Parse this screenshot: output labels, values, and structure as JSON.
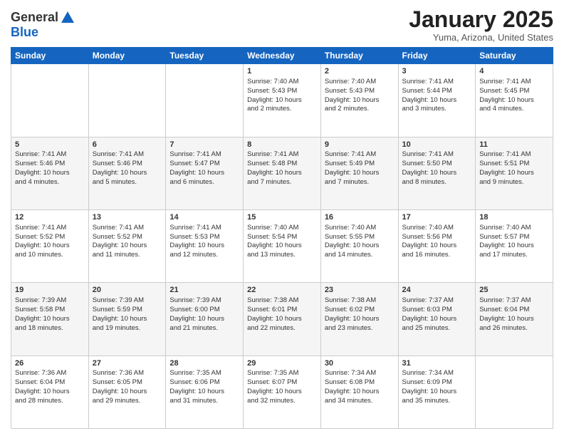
{
  "logo": {
    "general": "General",
    "blue": "Blue"
  },
  "header": {
    "month": "January 2025",
    "location": "Yuma, Arizona, United States"
  },
  "days_of_week": [
    "Sunday",
    "Monday",
    "Tuesday",
    "Wednesday",
    "Thursday",
    "Friday",
    "Saturday"
  ],
  "rows": [
    [
      {
        "day": "",
        "info": ""
      },
      {
        "day": "",
        "info": ""
      },
      {
        "day": "",
        "info": ""
      },
      {
        "day": "1",
        "info": "Sunrise: 7:40 AM\nSunset: 5:43 PM\nDaylight: 10 hours\nand 2 minutes."
      },
      {
        "day": "2",
        "info": "Sunrise: 7:40 AM\nSunset: 5:43 PM\nDaylight: 10 hours\nand 2 minutes."
      },
      {
        "day": "3",
        "info": "Sunrise: 7:41 AM\nSunset: 5:44 PM\nDaylight: 10 hours\nand 3 minutes."
      },
      {
        "day": "4",
        "info": "Sunrise: 7:41 AM\nSunset: 5:45 PM\nDaylight: 10 hours\nand 4 minutes."
      }
    ],
    [
      {
        "day": "5",
        "info": "Sunrise: 7:41 AM\nSunset: 5:46 PM\nDaylight: 10 hours\nand 4 minutes."
      },
      {
        "day": "6",
        "info": "Sunrise: 7:41 AM\nSunset: 5:46 PM\nDaylight: 10 hours\nand 5 minutes."
      },
      {
        "day": "7",
        "info": "Sunrise: 7:41 AM\nSunset: 5:47 PM\nDaylight: 10 hours\nand 6 minutes."
      },
      {
        "day": "8",
        "info": "Sunrise: 7:41 AM\nSunset: 5:48 PM\nDaylight: 10 hours\nand 7 minutes."
      },
      {
        "day": "9",
        "info": "Sunrise: 7:41 AM\nSunset: 5:49 PM\nDaylight: 10 hours\nand 7 minutes."
      },
      {
        "day": "10",
        "info": "Sunrise: 7:41 AM\nSunset: 5:50 PM\nDaylight: 10 hours\nand 8 minutes."
      },
      {
        "day": "11",
        "info": "Sunrise: 7:41 AM\nSunset: 5:51 PM\nDaylight: 10 hours\nand 9 minutes."
      }
    ],
    [
      {
        "day": "12",
        "info": "Sunrise: 7:41 AM\nSunset: 5:52 PM\nDaylight: 10 hours\nand 10 minutes."
      },
      {
        "day": "13",
        "info": "Sunrise: 7:41 AM\nSunset: 5:52 PM\nDaylight: 10 hours\nand 11 minutes."
      },
      {
        "day": "14",
        "info": "Sunrise: 7:41 AM\nSunset: 5:53 PM\nDaylight: 10 hours\nand 12 minutes."
      },
      {
        "day": "15",
        "info": "Sunrise: 7:40 AM\nSunset: 5:54 PM\nDaylight: 10 hours\nand 13 minutes."
      },
      {
        "day": "16",
        "info": "Sunrise: 7:40 AM\nSunset: 5:55 PM\nDaylight: 10 hours\nand 14 minutes."
      },
      {
        "day": "17",
        "info": "Sunrise: 7:40 AM\nSunset: 5:56 PM\nDaylight: 10 hours\nand 16 minutes."
      },
      {
        "day": "18",
        "info": "Sunrise: 7:40 AM\nSunset: 5:57 PM\nDaylight: 10 hours\nand 17 minutes."
      }
    ],
    [
      {
        "day": "19",
        "info": "Sunrise: 7:39 AM\nSunset: 5:58 PM\nDaylight: 10 hours\nand 18 minutes."
      },
      {
        "day": "20",
        "info": "Sunrise: 7:39 AM\nSunset: 5:59 PM\nDaylight: 10 hours\nand 19 minutes."
      },
      {
        "day": "21",
        "info": "Sunrise: 7:39 AM\nSunset: 6:00 PM\nDaylight: 10 hours\nand 21 minutes."
      },
      {
        "day": "22",
        "info": "Sunrise: 7:38 AM\nSunset: 6:01 PM\nDaylight: 10 hours\nand 22 minutes."
      },
      {
        "day": "23",
        "info": "Sunrise: 7:38 AM\nSunset: 6:02 PM\nDaylight: 10 hours\nand 23 minutes."
      },
      {
        "day": "24",
        "info": "Sunrise: 7:37 AM\nSunset: 6:03 PM\nDaylight: 10 hours\nand 25 minutes."
      },
      {
        "day": "25",
        "info": "Sunrise: 7:37 AM\nSunset: 6:04 PM\nDaylight: 10 hours\nand 26 minutes."
      }
    ],
    [
      {
        "day": "26",
        "info": "Sunrise: 7:36 AM\nSunset: 6:04 PM\nDaylight: 10 hours\nand 28 minutes."
      },
      {
        "day": "27",
        "info": "Sunrise: 7:36 AM\nSunset: 6:05 PM\nDaylight: 10 hours\nand 29 minutes."
      },
      {
        "day": "28",
        "info": "Sunrise: 7:35 AM\nSunset: 6:06 PM\nDaylight: 10 hours\nand 31 minutes."
      },
      {
        "day": "29",
        "info": "Sunrise: 7:35 AM\nSunset: 6:07 PM\nDaylight: 10 hours\nand 32 minutes."
      },
      {
        "day": "30",
        "info": "Sunrise: 7:34 AM\nSunset: 6:08 PM\nDaylight: 10 hours\nand 34 minutes."
      },
      {
        "day": "31",
        "info": "Sunrise: 7:34 AM\nSunset: 6:09 PM\nDaylight: 10 hours\nand 35 minutes."
      },
      {
        "day": "",
        "info": ""
      }
    ]
  ]
}
